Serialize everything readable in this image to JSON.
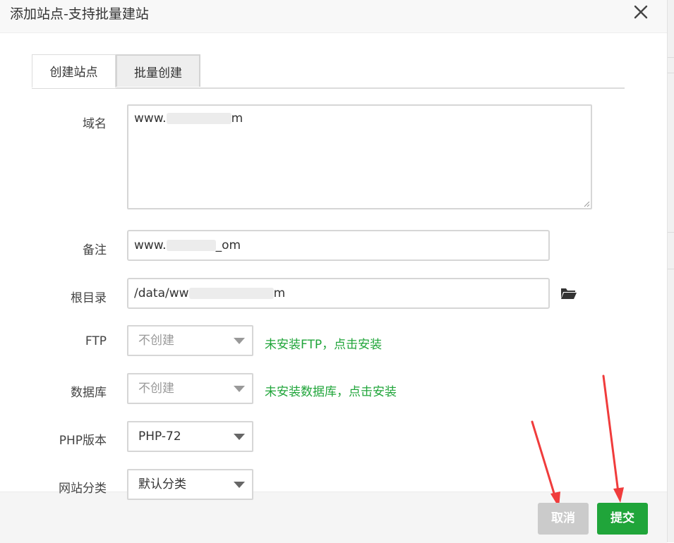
{
  "dialog": {
    "title": "添加站点-支持批量建站",
    "close_icon": "close-icon"
  },
  "tabs": [
    {
      "label": "创建站点",
      "active": true
    },
    {
      "label": "批量创建",
      "active": false
    }
  ],
  "form": {
    "domain": {
      "label": "域名",
      "value": "www.",
      "value_tail": "m"
    },
    "note": {
      "label": "备注",
      "value": "www.",
      "value_tail": "_om"
    },
    "root": {
      "label": "根目录",
      "value": "/data/ww",
      "value_tail": "m",
      "icon": "folder-open-icon"
    },
    "ftp": {
      "label": "FTP",
      "selected": "不创建",
      "link": "未安装FTP，点击安装"
    },
    "database": {
      "label": "数据库",
      "selected": "不创建",
      "link": "未安装数据库，点击安装"
    },
    "php": {
      "label": "PHP版本",
      "selected": "PHP-72"
    },
    "category": {
      "label": "网站分类",
      "selected": "默认分类"
    }
  },
  "footer": {
    "cancel_label": "取消",
    "submit_label": "提交"
  },
  "colors": {
    "accent": "#20a53a",
    "annotation_arrow": "#f03c3c"
  }
}
